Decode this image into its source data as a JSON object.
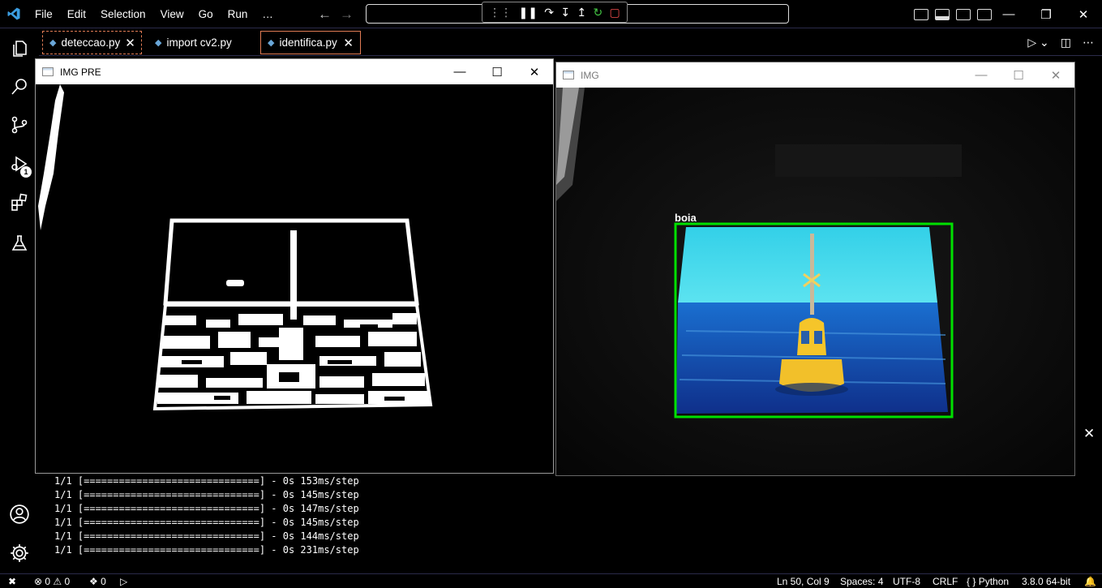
{
  "menu": [
    "File",
    "Edit",
    "Selection",
    "View",
    "Go",
    "Run",
    "…"
  ],
  "tabs": [
    {
      "label": "deteccao.py"
    },
    {
      "label": "import cv2.py"
    },
    {
      "label": "identifica.py"
    }
  ],
  "activity": {
    "debug_badge": "1"
  },
  "windows": {
    "pre": {
      "title": "IMG PRE"
    },
    "img": {
      "title": "IMG",
      "detection_label": "boia",
      "box_color": "#00e000"
    }
  },
  "terminal_lines": [
    "1/1 [==============================] - 0s 153ms/step",
    "1/1 [==============================] - 0s 145ms/step",
    "1/1 [==============================] - 0s 147ms/step",
    "1/1 [==============================] - 0s 145ms/step",
    "1/1 [==============================] - 0s 144ms/step",
    "1/1 [==============================] - 0s 231ms/step"
  ],
  "status": {
    "errors": "0",
    "warnings": "0",
    "ports": "0",
    "position": "Ln 50, Col 9",
    "spaces": "Spaces: 4",
    "encoding": "UTF-8",
    "eol": "CRLF",
    "language": "Python",
    "interpreter": "3.8.0 64-bit"
  },
  "colors": {
    "accent": "#0078d4",
    "tab_border": "#e07b54",
    "python_blue": "#6aa7d8"
  }
}
